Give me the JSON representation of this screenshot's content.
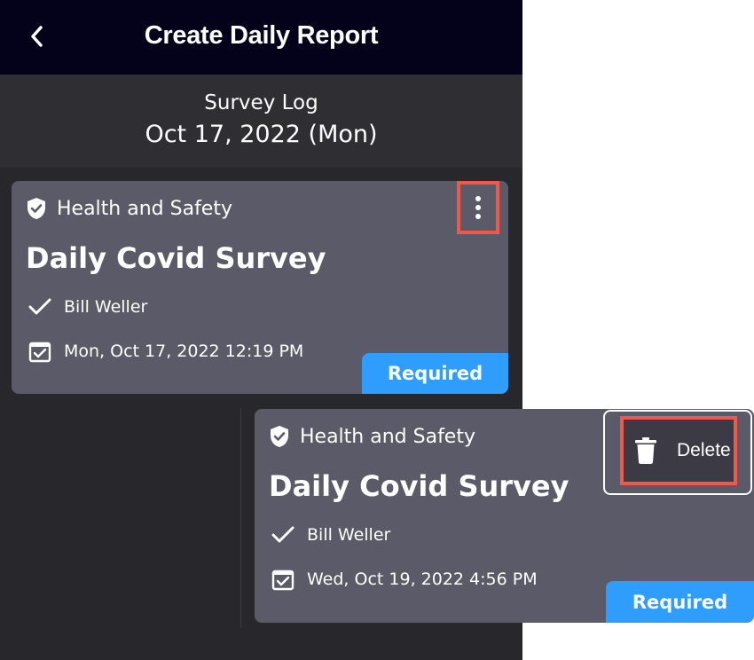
{
  "header": {
    "title": "Create Daily Report",
    "back_icon": "chevron-left-icon"
  },
  "log": {
    "title": "Survey Log",
    "date": "Oct 17, 2022 (Mon)"
  },
  "cards": [
    {
      "category": "Health and Safety",
      "category_icon": "shield-check-icon",
      "title": "Daily Covid Survey",
      "author": "Bill Weller",
      "author_icon": "checkmark-icon",
      "datetime": "Mon, Oct 17, 2022 12:19 PM",
      "datetime_icon": "calendar-check-icon",
      "badge": "Required",
      "menu_icon": "more-vertical-icon"
    },
    {
      "category": "Health and Safety",
      "category_icon": "shield-check-icon",
      "title": "Daily Covid Survey",
      "author": "Bill Weller",
      "author_icon": "checkmark-icon",
      "datetime": "Wed, Oct 19, 2022 4:56 PM",
      "datetime_icon": "calendar-check-icon",
      "badge": "Required"
    }
  ],
  "menu": {
    "delete_label": "Delete",
    "delete_icon": "trash-icon"
  },
  "colors": {
    "topbar": "#03021a",
    "background": "#28282c",
    "card": "#5b5a68",
    "badge": "#2e9dfb",
    "highlight": "#f1584b"
  }
}
